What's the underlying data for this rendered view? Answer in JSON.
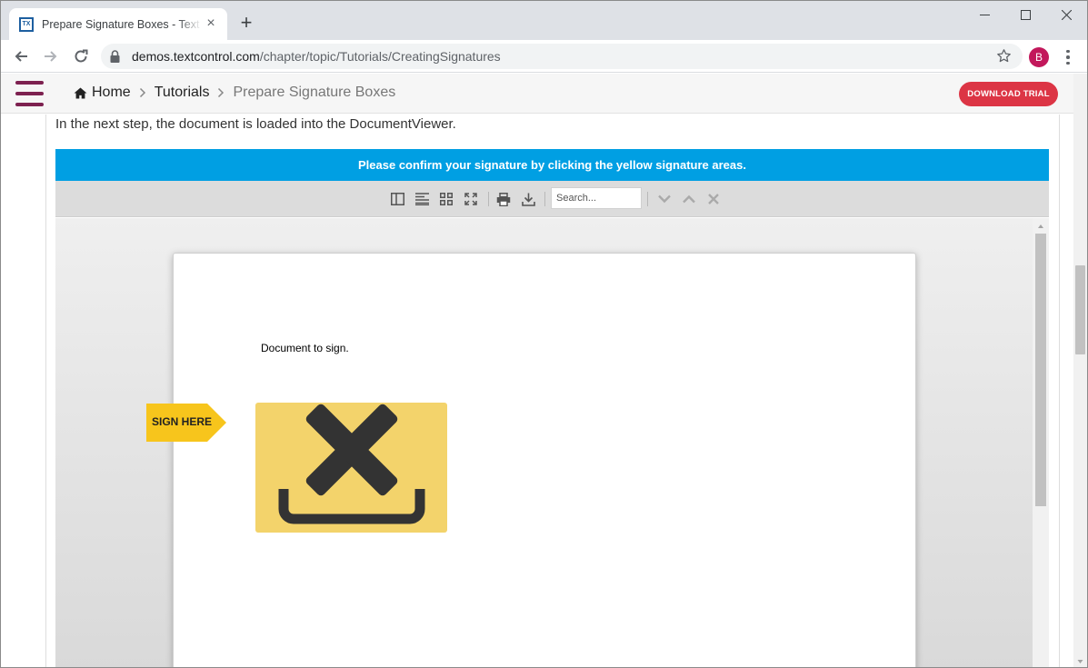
{
  "browser": {
    "tab_title": "Prepare Signature Boxes - Text Control",
    "favicon_text": "TX",
    "url_host": "demos.textcontrol.com",
    "url_path": "/chapter/topic/Tutorials/CreatingSignatures",
    "avatar_initial": "B"
  },
  "site": {
    "breadcrumbs": [
      {
        "label": "Home"
      },
      {
        "label": "Tutorials"
      },
      {
        "label": "Prepare Signature Boxes"
      }
    ],
    "download_label": "DOWNLOAD TRIAL",
    "accent_color": "#7d2150",
    "button_color": "#dc3545"
  },
  "content": {
    "intro": "In the next step, the document is loaded into the DocumentViewer.",
    "banner": "Please confirm your signature by clicking the yellow signature areas.",
    "banner_color": "#009fe3"
  },
  "viewer": {
    "search_placeholder": "Search...",
    "document_text": "Document to sign.",
    "sign_here_label": "SIGN HERE",
    "signature_box_color": "#f3d36b",
    "sign_here_color": "#f7c51c",
    "tool_icons": [
      "sidebar-icon",
      "text-align-icon",
      "thumbnails-icon",
      "fullscreen-icon",
      "print-icon",
      "download-icon",
      "next-result-icon",
      "previous-result-icon",
      "clear-search-icon"
    ]
  }
}
